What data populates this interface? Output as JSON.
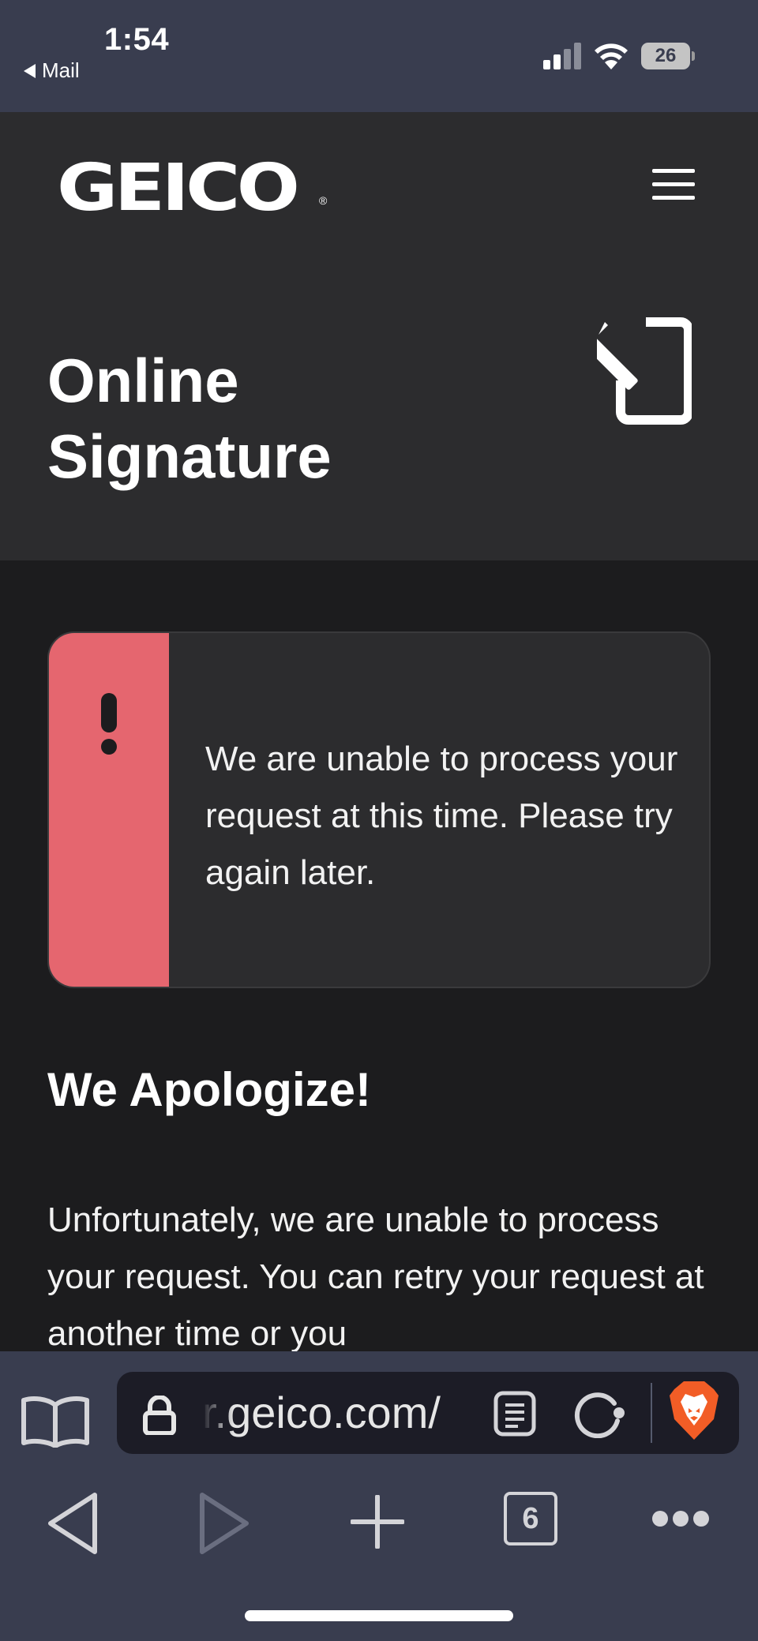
{
  "status_bar": {
    "time": "1:54",
    "back_label": "Mail",
    "battery": "26"
  },
  "header": {
    "logo": "GEICO",
    "logo_mark": "®",
    "title_line1": "Online",
    "title_line2": "Signature",
    "menu_icon": "hamburger-menu-icon",
    "feature_icon": "mobile-sign-icon"
  },
  "alert": {
    "icon": "exclamation-icon",
    "stripe_color": "#e5666f",
    "message": "We are unable to process your request at this time. Please try again later."
  },
  "content": {
    "heading": "We Apologize!",
    "body": "Unfortunately, we are unable to process your request. You can retry your request at another time or you"
  },
  "browser": {
    "url": "r.geico.com/",
    "open_tabs": "6",
    "icons": [
      "bookmarks-icon",
      "lock-icon",
      "reader-mode-icon",
      "reload-icon",
      "brave-shield-icon",
      "back-arrow-icon",
      "forward-arrow-icon",
      "new-tab-icon",
      "tabs-icon",
      "more-icon"
    ]
  }
}
